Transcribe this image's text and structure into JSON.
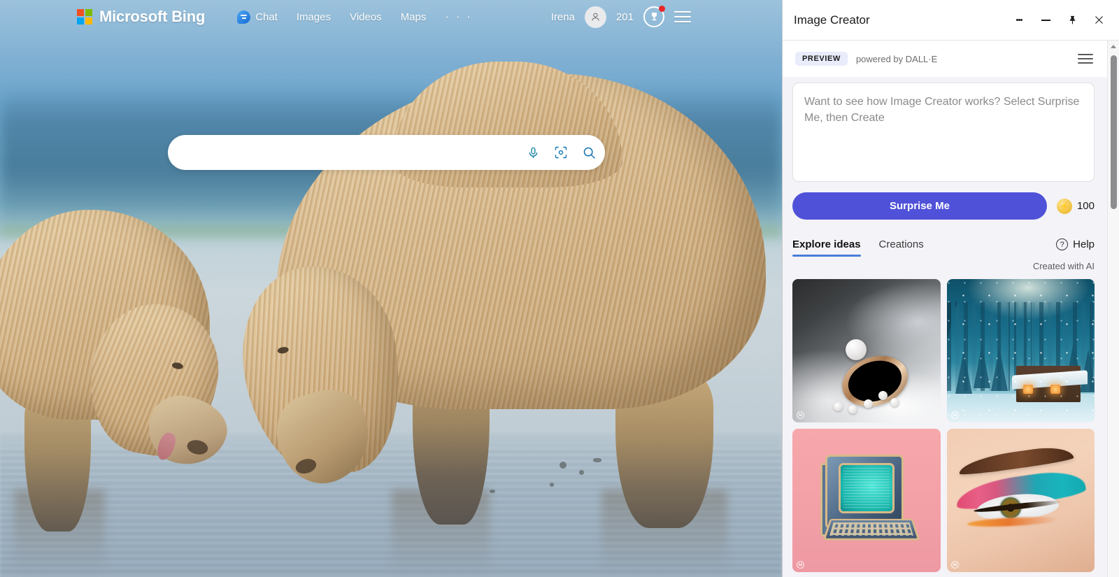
{
  "bing": {
    "logo_text": "Microsoft Bing",
    "logo_squares": [
      "#f25022",
      "#7fba00",
      "#00a4ef",
      "#ffb900"
    ],
    "nav": [
      {
        "name": "chat",
        "label": "Chat",
        "icon": "chat-bubble-icon"
      },
      {
        "name": "images",
        "label": "Images"
      },
      {
        "name": "videos",
        "label": "Videos"
      },
      {
        "name": "maps",
        "label": "Maps"
      },
      {
        "name": "more",
        "label": "· · ·"
      }
    ],
    "user_name": "Irena",
    "rewards_count": "201",
    "avatar_icon": "person-icon",
    "rewards_icon": "trophy-medal-icon",
    "hamburger_icon": "hamburger-menu-icon",
    "search": {
      "value": "",
      "placeholder": "",
      "mic_icon": "microphone-icon",
      "visual_icon": "visual-search-icon",
      "go_icon": "search-magnifier-icon"
    }
  },
  "image_creator": {
    "window_title": "Image Creator",
    "titlebar_actions": [
      {
        "name": "more-options",
        "icon": "kebab-menu-icon"
      },
      {
        "name": "minimize",
        "icon": "minimize-icon"
      },
      {
        "name": "pin",
        "icon": "pin-icon"
      },
      {
        "name": "close",
        "icon": "close-icon"
      }
    ],
    "preview_badge": "PREVIEW",
    "powered_by": "powered by DALL·E",
    "menu_icon": "hamburger-menu-icon",
    "prompt": {
      "value": "",
      "placeholder": "Want to see how Image Creator works? Select Surprise Me, then Create"
    },
    "surprise_button": "Surprise Me",
    "token_count": "100",
    "token_icon": "lightning-bolt-coin-icon",
    "accent_color": "#4f52d8",
    "tab_underline_color": "#4a7ddb",
    "tabs": [
      {
        "label": "Explore ideas",
        "active": true
      },
      {
        "label": "Creations",
        "active": false
      }
    ],
    "help": {
      "label": "Help",
      "icon": "question-circle-icon"
    },
    "created_with_ai": "Created with AI",
    "thumbnails": [
      {
        "name": "thumb-pearl-ring",
        "alt": "Ornate pearl ring resting on white silk fabric"
      },
      {
        "name": "thumb-snow-cabin",
        "alt": "Snow-covered log cabin in a winter pine forest"
      },
      {
        "name": "thumb-retro-computer",
        "alt": "Vintage desktop computer with teal screen on pink background"
      },
      {
        "name": "thumb-eye-makeup",
        "alt": "Close-up of an eye with colorful pink and teal eyeshadow"
      }
    ],
    "scrollbar": {
      "up_arrow_icon": "scroll-up-arrow-icon",
      "thumb_name": "scrollbar-thumb"
    }
  }
}
